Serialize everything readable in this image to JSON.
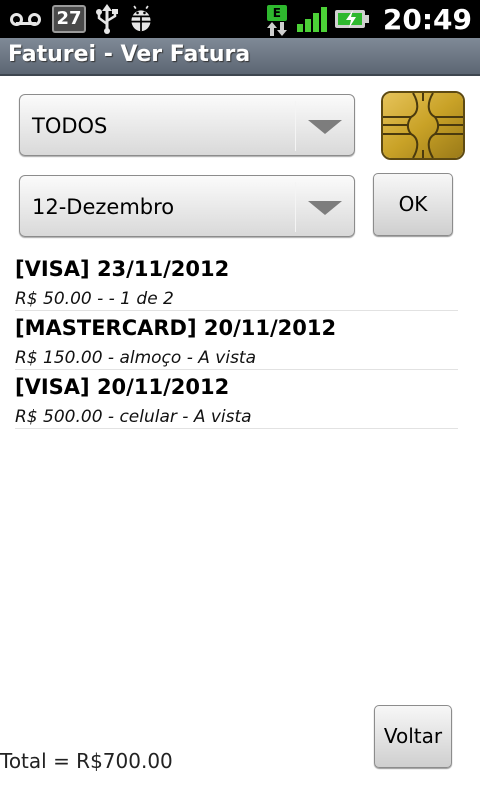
{
  "status_bar": {
    "date_badge": "27",
    "network_type": "E",
    "time": "20:49",
    "icons": [
      "voicemail-icon",
      "usb-icon",
      "android-debug-icon",
      "edge-data-icon",
      "signal-icon",
      "battery-charging-icon"
    ],
    "battery_level": 0.75,
    "signal_bars": 4
  },
  "title_bar": {
    "title": "Faturei - Ver Fatura"
  },
  "filters": {
    "card_spinner": {
      "selected": "TODOS"
    },
    "month_spinner": {
      "selected": "12-Dezembro"
    },
    "ok_label": "OK"
  },
  "invoices": [
    {
      "headline": "[VISA] 23/11/2012",
      "detail": "R$ 50.00 -  - 1 de 2"
    },
    {
      "headline": "[MASTERCARD] 20/11/2012",
      "detail": "R$ 150.00 - almoço - A vista"
    },
    {
      "headline": "[VISA] 20/11/2012",
      "detail": "R$ 500.00 - celular - A vista"
    }
  ],
  "footer": {
    "total": "Total = R$700.00",
    "back_label": "Voltar"
  },
  "colors": {
    "title_bar": "#6e7885",
    "signal": "#4cd137",
    "chip_gold": "#c9a227"
  }
}
